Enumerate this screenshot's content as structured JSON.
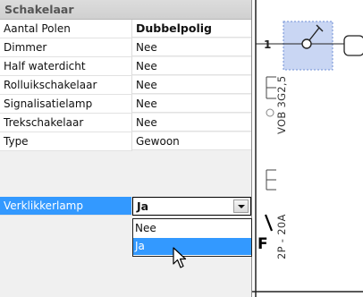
{
  "property_grid": {
    "header": "Schakelaar",
    "rows": [
      {
        "name": "Aantal Polen",
        "value": "Dubbelpolig"
      },
      {
        "name": "Dimmer",
        "value": "Nee"
      },
      {
        "name": "Half waterdicht",
        "value": "Nee"
      },
      {
        "name": "Rolluikschakelaar",
        "value": "Nee"
      },
      {
        "name": "Signalisatielamp",
        "value": "Nee"
      },
      {
        "name": "Trekschakelaar",
        "value": "Nee"
      },
      {
        "name": "Type",
        "value": "Gewoon"
      },
      {
        "name": "Verklikkerlamp",
        "value": "Ja"
      }
    ],
    "dropdown_options": [
      "Nee",
      "Ja"
    ],
    "highlighted_option": "Ja"
  },
  "schematic": {
    "circuit_number": "1",
    "vertical_label_1": "VOB 3G2,5",
    "vertical_label_2": "2P - 20A",
    "breaker_symbol": "F"
  },
  "colors": {
    "selection": "#3399ff",
    "panel_bg": "#f0f0f0",
    "dashed_box": "#6f8fd6"
  }
}
